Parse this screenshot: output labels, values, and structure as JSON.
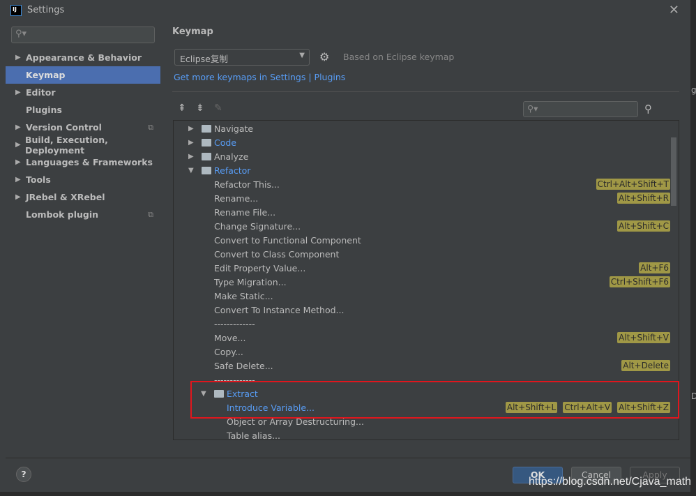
{
  "window": {
    "title": "Settings",
    "logo": "IJ"
  },
  "sidebar": {
    "search_placeholder": "",
    "items": [
      {
        "label": "Appearance & Behavior",
        "arrow": true
      },
      {
        "label": "Keymap",
        "selected": true
      },
      {
        "label": "Editor",
        "arrow": true
      },
      {
        "label": "Plugins"
      },
      {
        "label": "Version Control",
        "arrow": true,
        "copy": true
      },
      {
        "label": "Build, Execution, Deployment",
        "arrow": true
      },
      {
        "label": "Languages & Frameworks",
        "arrow": true
      },
      {
        "label": "Tools",
        "arrow": true
      },
      {
        "label": "JRebel & XRebel",
        "arrow": true
      },
      {
        "label": "Lombok plugin",
        "copy": true
      }
    ]
  },
  "main": {
    "heading": "Keymap",
    "keymap_value": "Eclipse复制",
    "based_on": "Based on Eclipse keymap",
    "link": "Get more keymaps in Settings | Plugins",
    "tree": [
      {
        "label": "Navigate",
        "level": 0,
        "folder": true,
        "expanded": false
      },
      {
        "label": "Code",
        "level": 0,
        "folder": true,
        "expanded": false,
        "blue": true
      },
      {
        "label": "Analyze",
        "level": 0,
        "folder": true,
        "expanded": false
      },
      {
        "label": "Refactor",
        "level": 0,
        "folder": true,
        "expanded": true,
        "blue": true
      },
      {
        "label": "Refactor This...",
        "level": 1,
        "keys": [
          "Ctrl+Alt+Shift+T"
        ]
      },
      {
        "label": "Rename...",
        "level": 1,
        "keys": [
          "Alt+Shift+R"
        ]
      },
      {
        "label": "Rename File...",
        "level": 1
      },
      {
        "label": "Change Signature...",
        "level": 1,
        "keys": [
          "Alt+Shift+C"
        ]
      },
      {
        "label": "Convert to Functional Component",
        "level": 1
      },
      {
        "label": "Convert to Class Component",
        "level": 1
      },
      {
        "label": "Edit Property Value...",
        "level": 1,
        "keys": [
          "Alt+F6"
        ]
      },
      {
        "label": "Type Migration...",
        "level": 1,
        "keys": [
          "Ctrl+Shift+F6"
        ]
      },
      {
        "label": "Make Static...",
        "level": 1
      },
      {
        "label": "Convert To Instance Method...",
        "level": 1
      },
      {
        "label": "-------------",
        "level": 1
      },
      {
        "label": "Move...",
        "level": 1,
        "keys": [
          "Alt+Shift+V"
        ]
      },
      {
        "label": "Copy...",
        "level": 1
      },
      {
        "label": "Safe Delete...",
        "level": 1,
        "keys": [
          "Alt+Delete"
        ]
      },
      {
        "label": "-------------",
        "level": 1
      },
      {
        "label": "Extract",
        "level": 1,
        "folder": true,
        "expanded": true,
        "blue": true
      },
      {
        "label": "Introduce Variable...",
        "level": 2,
        "blue": true,
        "keys": [
          "Alt+Shift+L",
          "Ctrl+Alt+V",
          "Alt+Shift+Z"
        ]
      },
      {
        "label": "Object or Array Destructuring...",
        "level": 2
      },
      {
        "label": "Table alias...",
        "level": 2
      }
    ]
  },
  "footer": {
    "help": "?",
    "ok": "OK",
    "cancel": "Cancel",
    "apply": "Apply"
  },
  "watermark": "https://blog.csdn.net/Cjava_math",
  "colors": {
    "accent": "#4b6eaf",
    "link": "#589df6",
    "shortcut": "#a09846",
    "highlight_box": "#e0161d"
  }
}
